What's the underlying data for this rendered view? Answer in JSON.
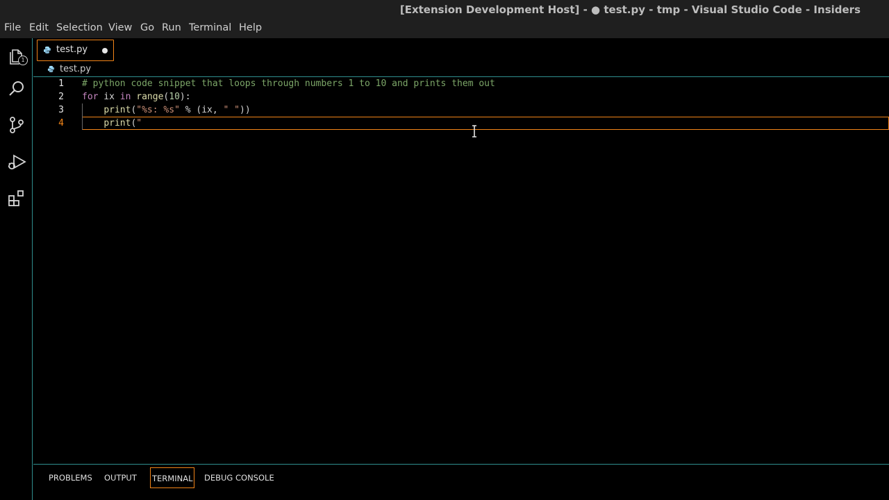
{
  "window": {
    "title": "[Extension Development Host] - ● test.py - tmp - Visual Studio Code - Insiders"
  },
  "menu": [
    "File",
    "Edit",
    "Selection",
    "View",
    "Go",
    "Run",
    "Terminal",
    "Help"
  ],
  "activity": {
    "explorer_badge": "1",
    "icons": [
      "files-icon",
      "search-icon",
      "source-control-icon",
      "run-debug-icon",
      "extensions-icon"
    ]
  },
  "tab": {
    "label": "test.py",
    "modified": true
  },
  "breadcrumb": {
    "file": "test.py"
  },
  "editor": {
    "lines": [
      {
        "number": "1",
        "comment": "# python code snippet that loops through numbers 1 to 10 and prints them out"
      },
      {
        "number": "2",
        "kw1": "for",
        "t1": " ix ",
        "kw2": "in",
        "t2": " ",
        "fn": "range",
        "t3": "(",
        "num": "10",
        "t4": "):"
      },
      {
        "number": "3",
        "indent": "    ",
        "fn": "print",
        "t1": "(",
        "s1": "\"%s: %s\"",
        "t2": " % (ix, ",
        "s2": "\" \"",
        "t3": "))"
      },
      {
        "number": "4",
        "indent": "    ",
        "fn": "print",
        "t1": "(",
        "s1": "\""
      }
    ],
    "active_line": "4"
  },
  "panel": {
    "tabs": [
      "PROBLEMS",
      "OUTPUT",
      "TERMINAL",
      "DEBUG CONSOLE"
    ],
    "active": "TERMINAL"
  },
  "colors": {
    "accent": "#f38518",
    "border": "#2f8f8f",
    "comment": "#7ca668",
    "keyword": "#c586c0",
    "function": "#dcdcaa",
    "string": "#ce9178",
    "number": "#b5cea8"
  }
}
